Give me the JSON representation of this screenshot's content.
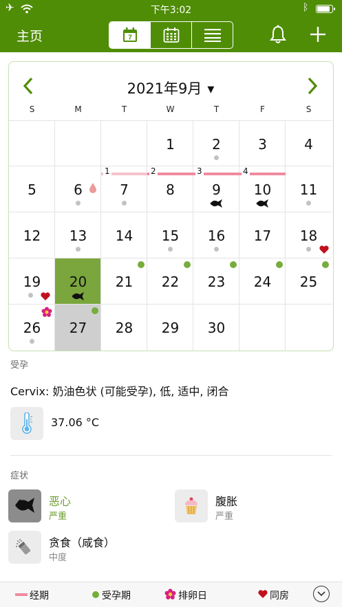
{
  "status_bar": {
    "time": "下午3:02",
    "battery_level": 0.92
  },
  "nav": {
    "home_label": "主页",
    "active_view": "day"
  },
  "calendar": {
    "month_title": "2021年9月",
    "weekdays": [
      "S",
      "M",
      "T",
      "W",
      "T",
      "F",
      "S"
    ],
    "days": [
      "1",
      "2",
      "3",
      "4",
      "5",
      "6",
      "7",
      "8",
      "9",
      "10",
      "11",
      "12",
      "13",
      "14",
      "15",
      "16",
      "17",
      "18",
      "19",
      "20",
      "21",
      "22",
      "23",
      "24",
      "25",
      "26",
      "27",
      "28",
      "29",
      "30"
    ],
    "period_day_labels": [
      "1",
      "2",
      "3",
      "4"
    ],
    "selected_day": "20",
    "today": "27"
  },
  "fertility": {
    "section_label": "受孕",
    "cervix_text": "Cervix: 奶油色状 (可能受孕), 低, 适中, 闭合",
    "temperature": "37.06 °C"
  },
  "symptoms": {
    "section_label": "症状",
    "items": [
      {
        "name": "恶心",
        "severity": "严重",
        "icon": "nausea-fish-icon"
      },
      {
        "name": "腹胀",
        "severity": "严重",
        "icon": "cupcake-icon"
      },
      {
        "name": "贪食（咸食）",
        "severity": "中度",
        "icon": "salt-shaker-icon"
      }
    ]
  },
  "legend": {
    "period": "经期",
    "fertile": "受孕期",
    "ovulation": "排卵日",
    "intercourse": "同房"
  },
  "colors": {
    "brand_green": "#4f8d06",
    "selected_green": "#7aa63d",
    "fertile_dot": "#76ad3d",
    "period_pink": "#f08a9f",
    "intercourse_red": "#c0111f"
  }
}
